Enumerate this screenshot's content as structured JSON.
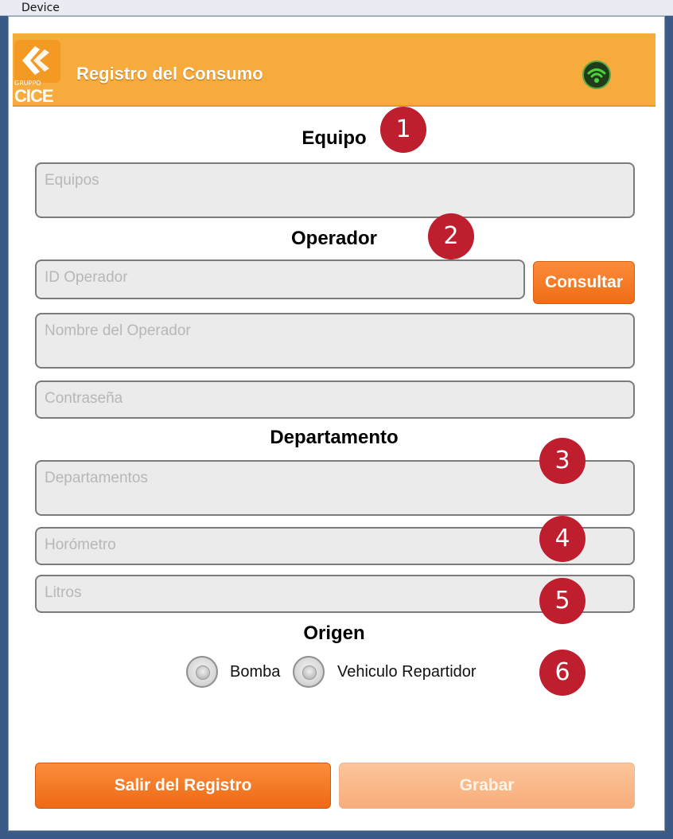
{
  "window": {
    "title": "Device"
  },
  "header": {
    "logo_top_text": "GRUPPO",
    "logo_bottom_text": "CICE",
    "title": "Registro del Consumo",
    "wifi_icon": "wifi-icon",
    "colors": {
      "bar": "#f6ab3c",
      "accent": "#ef6d16"
    }
  },
  "sections": {
    "equipo": {
      "title": "Equipo",
      "field_placeholder": "Equipos"
    },
    "operador": {
      "title": "Operador",
      "id_placeholder": "ID Operador",
      "consult_button": "Consultar",
      "name_placeholder": "Nombre del Operador",
      "password_placeholder": "Contraseña"
    },
    "departamento": {
      "title": "Departamento",
      "field_placeholder": "Departamentos",
      "horometro_placeholder": "Horómetro",
      "litros_placeholder": "Litros"
    },
    "origen": {
      "title": "Origen",
      "options": [
        "Bomba",
        "Vehiculo Repartidor"
      ]
    }
  },
  "actions": {
    "exit_label": "Salir del Registro",
    "save_label": "Grabar"
  },
  "markers": [
    "1",
    "2",
    "3",
    "4",
    "5",
    "6"
  ]
}
